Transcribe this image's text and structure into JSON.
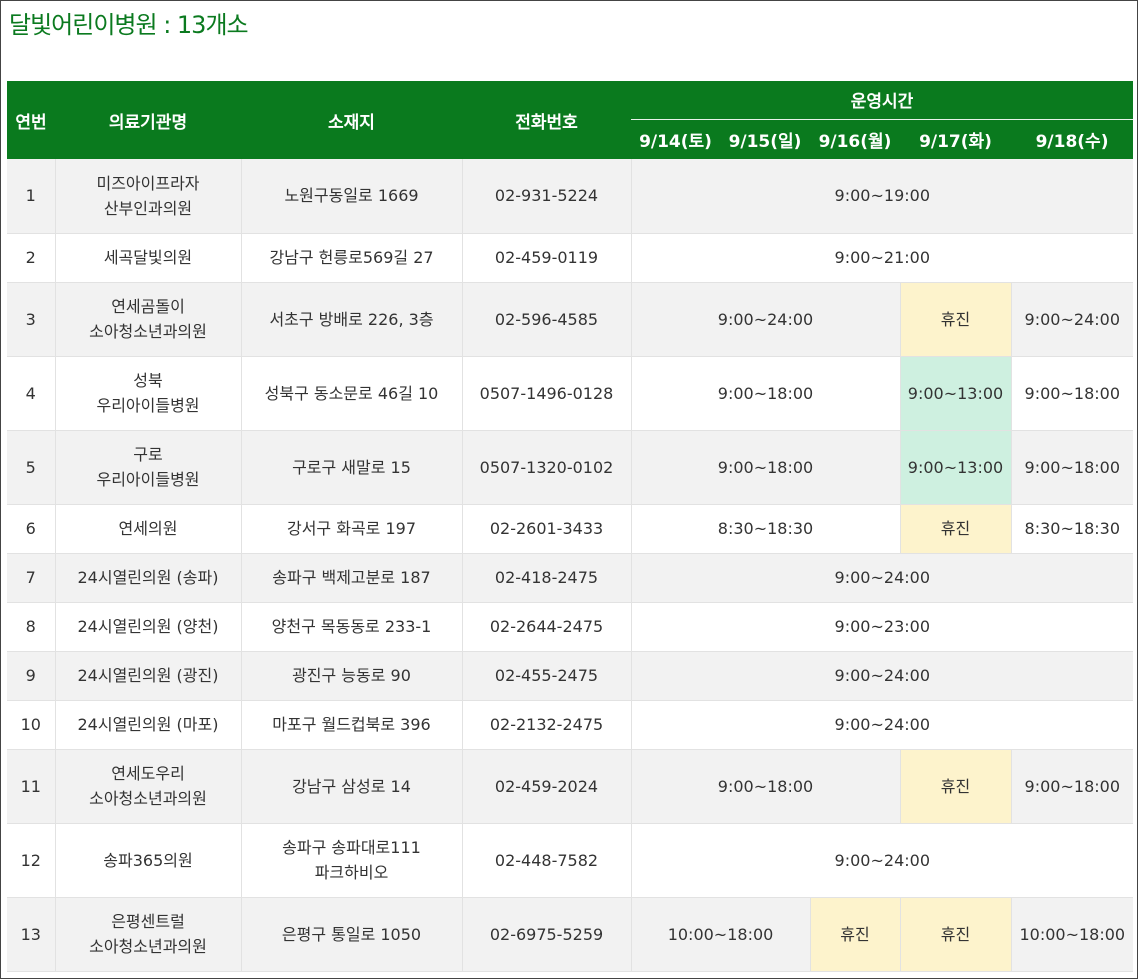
{
  "title": "달빛어린이병원 : 13개소",
  "header": {
    "no": "연번",
    "name": "의료기관명",
    "address": "소재지",
    "phone": "전화번호",
    "hours": "운영시간",
    "days": [
      "9/14(토)",
      "9/15(일)",
      "9/16(월)",
      "9/17(화)",
      "9/18(수)"
    ]
  },
  "rows": [
    {
      "no": "1",
      "name": [
        "미즈아이프라자",
        "산부인과의원"
      ],
      "address": [
        "노원구동일로 1669"
      ],
      "phone": "02-931-5224",
      "hours": [
        {
          "text": "9:00~19:00",
          "span": 5,
          "status": "open"
        }
      ]
    },
    {
      "no": "2",
      "name": [
        "세곡달빛의원"
      ],
      "address": [
        "강남구 헌릉로569길 27"
      ],
      "phone": "02-459-0119",
      "hours": [
        {
          "text": "9:00~21:00",
          "span": 5,
          "status": "open"
        }
      ]
    },
    {
      "no": "3",
      "name": [
        "연세곰돌이",
        "소아청소년과의원"
      ],
      "address": [
        "서초구 방배로 226, 3층"
      ],
      "phone": "02-596-4585",
      "hours": [
        {
          "text": "9:00~24:00",
          "span": 3,
          "status": "open"
        },
        {
          "text": "휴진",
          "span": 1,
          "status": "closed"
        },
        {
          "text": "9:00~24:00",
          "span": 1,
          "status": "open"
        }
      ]
    },
    {
      "no": "4",
      "name": [
        "성북",
        "우리아이들병원"
      ],
      "address": [
        "성북구 동소문로 46길 10"
      ],
      "phone": "0507-1496-0128",
      "hours": [
        {
          "text": "9:00~18:00",
          "span": 3,
          "status": "open"
        },
        {
          "text": "9:00~13:00",
          "span": 1,
          "status": "short"
        },
        {
          "text": "9:00~18:00",
          "span": 1,
          "status": "open"
        }
      ]
    },
    {
      "no": "5",
      "name": [
        "구로",
        "우리아이들병원"
      ],
      "address": [
        "구로구 새말로 15"
      ],
      "phone": "0507-1320-0102",
      "hours": [
        {
          "text": "9:00~18:00",
          "span": 3,
          "status": "open"
        },
        {
          "text": "9:00~13:00",
          "span": 1,
          "status": "short"
        },
        {
          "text": "9:00~18:00",
          "span": 1,
          "status": "open"
        }
      ]
    },
    {
      "no": "6",
      "name": [
        "연세의원"
      ],
      "address": [
        "강서구 화곡로 197"
      ],
      "phone": "02-2601-3433",
      "hours": [
        {
          "text": "8:30~18:30",
          "span": 3,
          "status": "open"
        },
        {
          "text": "휴진",
          "span": 1,
          "status": "closed"
        },
        {
          "text": "8:30~18:30",
          "span": 1,
          "status": "open"
        }
      ]
    },
    {
      "no": "7",
      "name": [
        "24시열린의원 (송파)"
      ],
      "address": [
        "송파구 백제고분로 187"
      ],
      "phone": "02-418-2475",
      "hours": [
        {
          "text": "9:00~24:00",
          "span": 5,
          "status": "open"
        }
      ]
    },
    {
      "no": "8",
      "name": [
        "24시열린의원 (양천)"
      ],
      "address": [
        "양천구 목동동로 233-1"
      ],
      "phone": "02-2644-2475",
      "hours": [
        {
          "text": "9:00~23:00",
          "span": 5,
          "status": "open"
        }
      ]
    },
    {
      "no": "9",
      "name": [
        "24시열린의원 (광진)"
      ],
      "address": [
        "광진구 능동로 90"
      ],
      "phone": "02-455-2475",
      "hours": [
        {
          "text": "9:00~24:00",
          "span": 5,
          "status": "open"
        }
      ]
    },
    {
      "no": "10",
      "name": [
        "24시열린의원 (마포)"
      ],
      "address": [
        "마포구 월드컵북로 396"
      ],
      "phone": "02-2132-2475",
      "hours": [
        {
          "text": "9:00~24:00",
          "span": 5,
          "status": "open"
        }
      ]
    },
    {
      "no": "11",
      "name": [
        "연세도우리",
        "소아청소년과의원"
      ],
      "address": [
        "강남구 삼성로 14"
      ],
      "phone": "02-459-2024",
      "hours": [
        {
          "text": "9:00~18:00",
          "span": 3,
          "status": "open"
        },
        {
          "text": "휴진",
          "span": 1,
          "status": "closed"
        },
        {
          "text": "9:00~18:00",
          "span": 1,
          "status": "open"
        }
      ]
    },
    {
      "no": "12",
      "name": [
        "송파365의원"
      ],
      "address": [
        "송파구 송파대로111",
        "파크하비오"
      ],
      "phone": "02-448-7582",
      "hours": [
        {
          "text": "9:00~24:00",
          "span": 5,
          "status": "open"
        }
      ]
    },
    {
      "no": "13",
      "name": [
        "은평센트럴",
        "소아청소년과의원"
      ],
      "address": [
        "은평구 통일로 1050"
      ],
      "phone": "02-6975-5259",
      "hours": [
        {
          "text": "10:00~18:00",
          "span": 2,
          "status": "open"
        },
        {
          "text": "휴진",
          "span": 1,
          "status": "closed"
        },
        {
          "text": "휴진",
          "span": 1,
          "status": "closed"
        },
        {
          "text": "10:00~18:00",
          "span": 1,
          "status": "open"
        }
      ]
    }
  ],
  "colors": {
    "header_bg": "#0a7a1e",
    "title": "#0b7a1f",
    "closed_bg": "#fdf3cc",
    "short_hours_bg": "#cef0e0",
    "alt_row_bg": "#f2f2f2"
  }
}
